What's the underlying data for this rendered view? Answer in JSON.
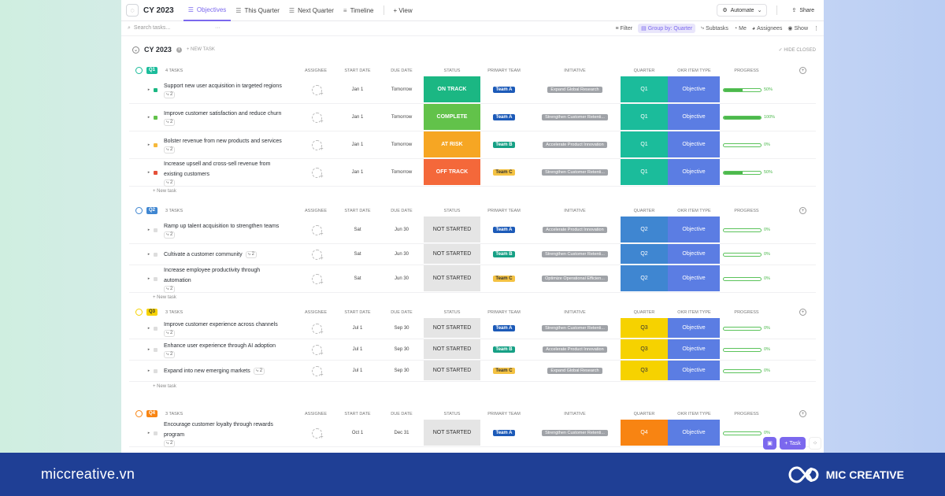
{
  "topbar": {
    "title": "CY 2023",
    "tabs": [
      {
        "label": "Objectives",
        "active": true
      },
      {
        "label": "This Quarter",
        "active": false
      },
      {
        "label": "Next Quarter",
        "active": false
      },
      {
        "label": "Timeline",
        "active": false
      }
    ],
    "add_view": "+ View",
    "automate": "Automate",
    "share": "Share"
  },
  "toolbar": {
    "search_placeholder": "Search tasks...",
    "filter": "Filter",
    "group_by": "Group by: Quarter",
    "subtasks": "Subtasks",
    "me": "Me",
    "assignees": "Assignees",
    "show": "Show"
  },
  "list": {
    "title": "CY 2023",
    "new_task": "+ NEW TASK",
    "hide_closed": "HIDE CLOSED"
  },
  "columns": {
    "assignee": "ASSIGNEE",
    "start_date": "START DATE",
    "due_date": "DUE DATE",
    "status": "STATUS",
    "primary_team": "PRIMARY TEAM",
    "initiative": "INITIATIVE",
    "quarter": "QUARTER",
    "okr_type": "OKR ITEM TYPE",
    "progress": "PROGRESS"
  },
  "add_task_label": "+ New task",
  "colors": {
    "on_track": "#1bb783",
    "complete": "#62c24a",
    "at_risk": "#f6a623",
    "off_track": "#f4683a",
    "not_started": "#e5e5e5",
    "q1": "#1bbc9b",
    "q2": "#3f86d1",
    "q3": "#f6d200",
    "q4": "#f88412",
    "okr": "#5b7de3",
    "team_a": "#1c5ab8",
    "team_b": "#16a085",
    "team_c": "#f4c242"
  },
  "groups": [
    {
      "badge": "Q1",
      "count": "4 TASKS",
      "tasks": [
        {
          "name": "Support new user acquisition in targeted regions",
          "subtasks": "2",
          "start": "Jan 1",
          "due": "Tomorrow",
          "status": "ON TRACK",
          "team": "Team A",
          "initiative": "Expand Global Research",
          "quarter": "Q1",
          "okr": "Objective",
          "progress": "50%"
        },
        {
          "name": "Improve customer satisfaction and reduce churn",
          "subtasks": "2",
          "start": "Jan 1",
          "due": "Tomorrow",
          "status": "COMPLETE",
          "team": "Team A",
          "initiative": "Strengthen Customer Retenti...",
          "quarter": "Q1",
          "okr": "Objective",
          "progress": "100%"
        },
        {
          "name": "Bolster revenue from new products and services",
          "subtasks": "2",
          "start": "Jan 1",
          "due": "Tomorrow",
          "status": "AT RISK",
          "team": "Team B",
          "initiative": "Accelerate Product Innovation",
          "quarter": "Q1",
          "okr": "Objective",
          "progress": "0%"
        },
        {
          "name": "Increase upsell and cross-sell revenue from existing customers",
          "subtasks": "2",
          "start": "Jan 1",
          "due": "Tomorrow",
          "status": "OFF TRACK",
          "team": "Team C",
          "initiative": "Strengthen Customer Retenti...",
          "quarter": "Q1",
          "okr": "Objective",
          "progress": "50%"
        }
      ]
    },
    {
      "badge": "Q2",
      "count": "3 TASKS",
      "tasks": [
        {
          "name": "Ramp up talent acquisition to strengthen teams",
          "subtasks": "2",
          "start": "Sat",
          "due": "Jun 30",
          "status": "NOT STARTED",
          "team": "Team A",
          "initiative": "Accelerate Product Innovation",
          "quarter": "Q2",
          "okr": "Objective",
          "progress": "0%"
        },
        {
          "name": "Cultivate a customer community",
          "subtasks": "2",
          "start": "Sat",
          "due": "Jun 30",
          "status": "NOT STARTED",
          "team": "Team B",
          "initiative": "Strengthen Customer Retenti...",
          "quarter": "Q2",
          "okr": "Objective",
          "progress": "0%"
        },
        {
          "name": "Increase employee productivity through automation",
          "subtasks": "2",
          "start": "Sat",
          "due": "Jun 30",
          "status": "NOT STARTED",
          "team": "Team C",
          "initiative": "Optimize Operational Efficien...",
          "quarter": "Q2",
          "okr": "Objective",
          "progress": "0%"
        }
      ]
    },
    {
      "badge": "Q3",
      "count": "3 TASKS",
      "tasks": [
        {
          "name": "Improve customer experience across channels",
          "subtasks": "2",
          "start": "Jul 1",
          "due": "Sep 30",
          "status": "NOT STARTED",
          "team": "Team A",
          "initiative": "Strengthen Customer Retenti...",
          "quarter": "Q3",
          "okr": "Objective",
          "progress": "0%"
        },
        {
          "name": "Enhance user experience through AI adoption",
          "subtasks": "2",
          "start": "Jul 1",
          "due": "Sep 30",
          "status": "NOT STARTED",
          "team": "Team B",
          "initiative": "Accelerate Product Innovation",
          "quarter": "Q3",
          "okr": "Objective",
          "progress": "0%"
        },
        {
          "name": "Expand into new emerging markets",
          "subtasks": "2",
          "start": "Jul 1",
          "due": "Sep 30",
          "status": "NOT STARTED",
          "team": "Team C",
          "initiative": "Expand Global Research",
          "quarter": "Q3",
          "okr": "Objective",
          "progress": "0%"
        }
      ]
    },
    {
      "badge": "Q4",
      "count": "3 TASKS",
      "tasks": [
        {
          "name": "Encourage customer loyalty through rewards program",
          "subtasks": "2",
          "start": "Oct 1",
          "due": "Dec 31",
          "status": "NOT STARTED",
          "team": "Team A",
          "initiative": "Strengthen Customer Retenti...",
          "quarter": "Q4",
          "okr": "Objective",
          "progress": "0%"
        }
      ]
    }
  ],
  "fab": {
    "task": "Task"
  },
  "footer": {
    "site": "miccreative.vn",
    "brand": "MIC CREATIVE"
  }
}
